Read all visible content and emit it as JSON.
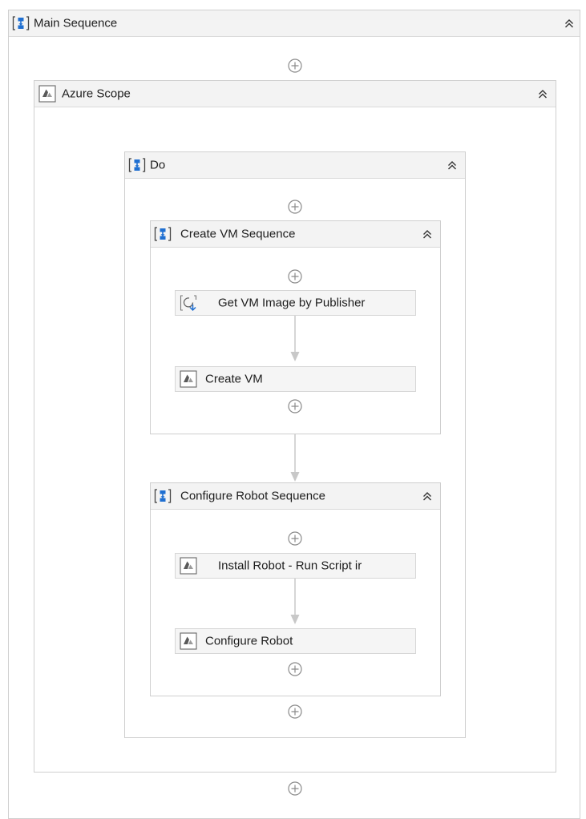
{
  "main_sequence": {
    "title": "Main Sequence"
  },
  "azure_scope": {
    "title": "Azure Scope"
  },
  "do": {
    "title": "Do"
  },
  "create_vm_sequence": {
    "title": "Create VM Sequence",
    "activities": [
      "Get VM Image by Publisher",
      "Create VM"
    ]
  },
  "configure_robot_sequence": {
    "title": "Configure Robot Sequence",
    "activities": [
      "Install Robot - Run Script ir",
      "Configure Robot"
    ]
  },
  "colors": {
    "accent": "#1f6fd1",
    "azure_icon": "#4a4a4a",
    "connector": "#c8c8c8"
  },
  "icons": {
    "sequence": "sequence-brackets-icon",
    "scope": "azure-scope-icon",
    "collapse": "double-chevron-up-icon",
    "add": "circle-plus-icon"
  }
}
